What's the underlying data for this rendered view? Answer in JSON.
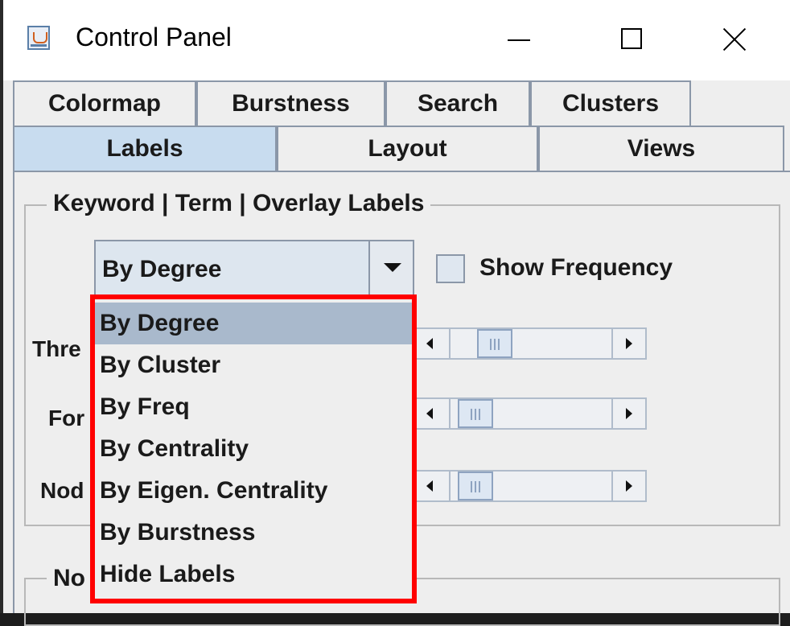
{
  "window": {
    "title": "Control Panel",
    "icon": "java-cup-icon"
  },
  "tabs": {
    "row1": [
      "Colormap",
      "Burstness",
      "Search",
      "Clusters"
    ],
    "row2": [
      "Labels",
      "Layout",
      "Views"
    ],
    "selected": "Labels"
  },
  "keyword_group": {
    "title": "Keyword | Term | Overlay Labels",
    "combo_value": "By Degree",
    "show_frequency_label": "Show Frequency",
    "show_frequency_checked": false,
    "rows": [
      {
        "label": "Thre",
        "slider_value": 0.22
      },
      {
        "label": "For",
        "slider_value": 0.07
      },
      {
        "label": "Nod",
        "slider_value": 0.07
      }
    ]
  },
  "node_group": {
    "title": "No"
  },
  "dropdown": {
    "items": [
      "By Degree",
      "By Cluster",
      "By Freq",
      "By Centrality",
      "By Eigen. Centrality",
      "By Burstness",
      "Hide Labels"
    ],
    "selected_index": 0
  }
}
